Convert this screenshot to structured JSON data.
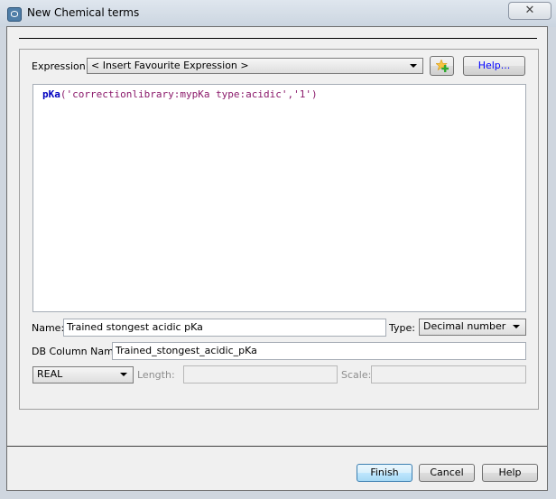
{
  "window": {
    "title": "New Chemical terms",
    "close_label": "✕"
  },
  "expression": {
    "label": "Expression:",
    "favourite_selected": "< Insert Favourite Expression >",
    "help_label": "Help...",
    "code": {
      "function": "pKa",
      "open": "(",
      "arg1": "'correctionlibrary:mypKa type:acidic'",
      "sep": ",",
      "arg2": "'1'",
      "close": ")"
    }
  },
  "form": {
    "name_label": "Name:",
    "name_value": "Trained stongest acidic pKa",
    "type_label": "Type:",
    "type_selected": "Decimal number",
    "db_column_label": "DB Column Name:",
    "db_column_value": "Trained_stongest_acidic_pKa",
    "sql_type_selected": "REAL",
    "length_label": "Length:",
    "length_value": "",
    "scale_label": "Scale:",
    "scale_value": ""
  },
  "buttons": {
    "finish": "Finish",
    "cancel": "Cancel",
    "help": "Help"
  },
  "colors": {
    "code_function": "#0000c0",
    "code_string": "#8b1a6b",
    "help_link": "#0000ff"
  }
}
